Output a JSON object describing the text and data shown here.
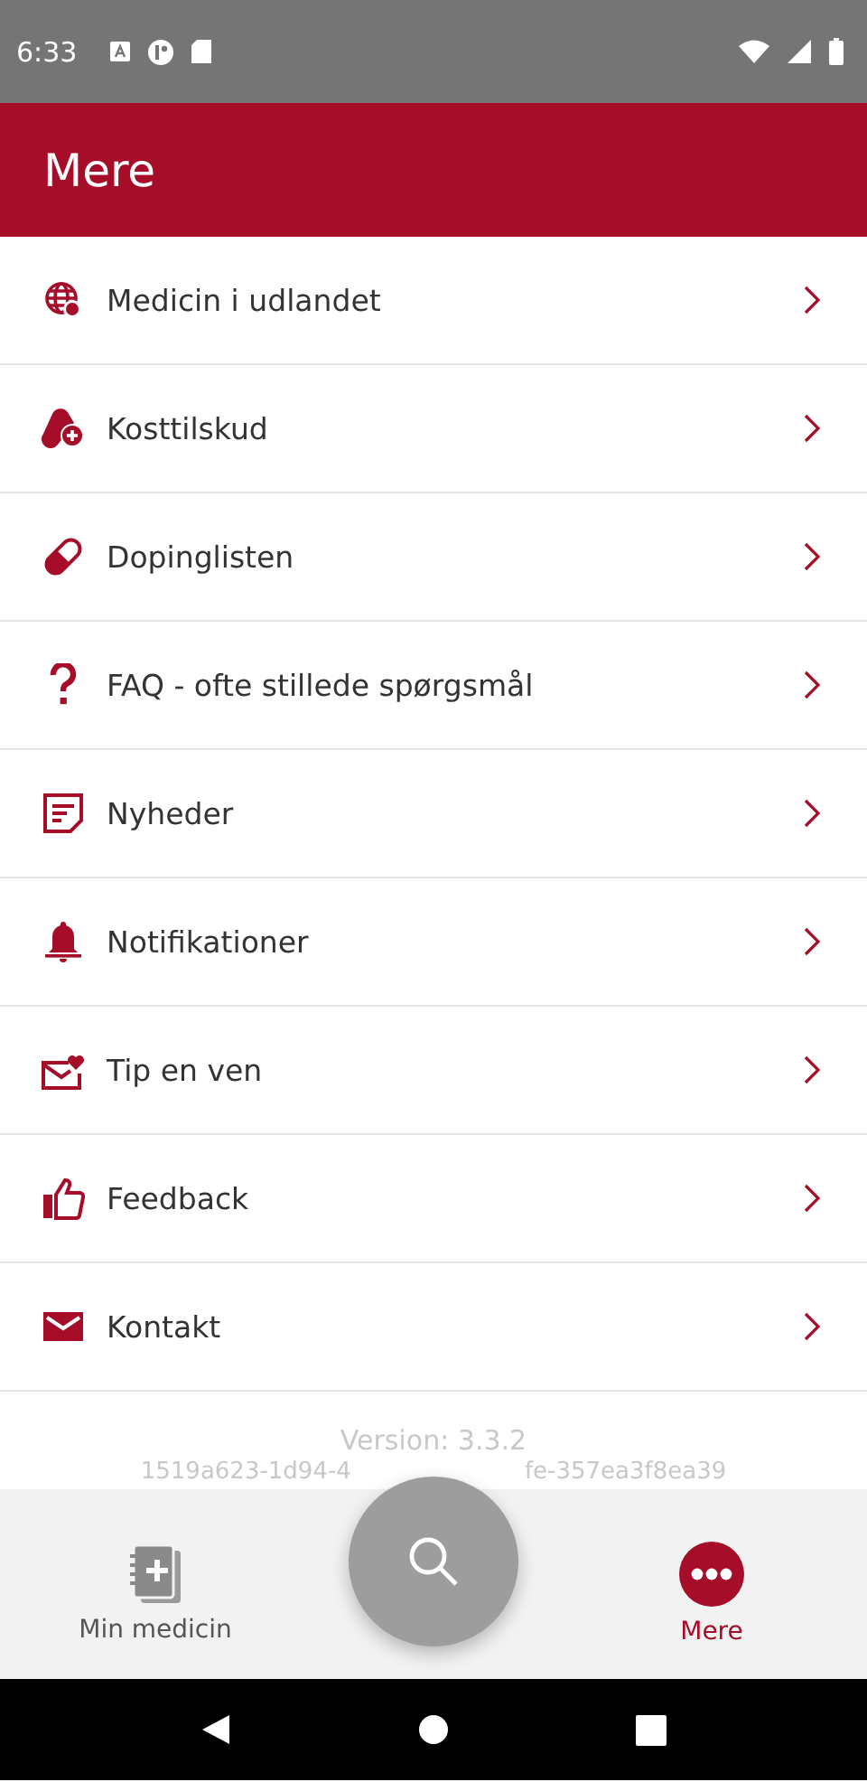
{
  "status_bar": {
    "time": "6:33"
  },
  "header": {
    "title": "Mere"
  },
  "menu": [
    {
      "label": "Medicin i udlandet"
    },
    {
      "label": "Kosttilskud"
    },
    {
      "label": "Dopinglisten"
    },
    {
      "label": "FAQ - ofte stillede spørgsmål"
    },
    {
      "label": "Nyheder"
    },
    {
      "label": "Notifikationer"
    },
    {
      "label": "Tip en ven"
    },
    {
      "label": "Feedback"
    },
    {
      "label": "Kontakt"
    }
  ],
  "version": {
    "label": "Version: 3.3.2",
    "build_left": "1519a623-1d94-4",
    "build_right": "fe-357ea3f8ea39"
  },
  "bottom_nav": [
    {
      "label": "Min medicin",
      "selected": false
    },
    {
      "label": "Mere",
      "selected": true
    }
  ]
}
